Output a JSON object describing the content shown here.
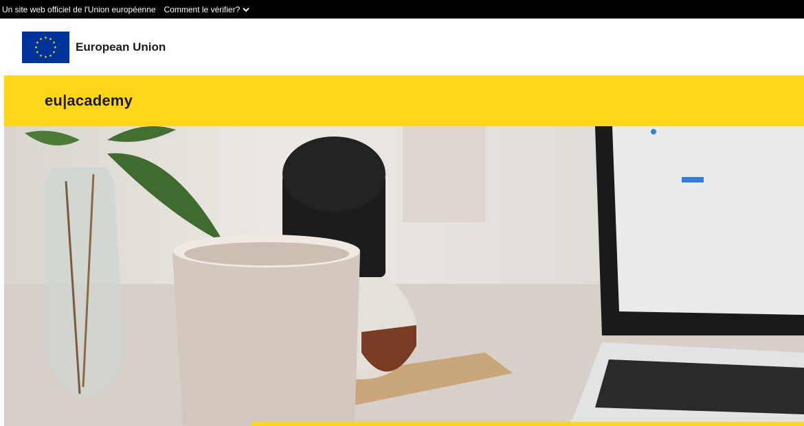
{
  "top_banner": {
    "official_text": "Un site web officiel de l'Union européenne",
    "verify_link": "Comment le vérifier?",
    "verify_icon": "chevron-down-icon"
  },
  "identity": {
    "name": "European Union",
    "flag_icon": "eu-flag-icon"
  },
  "academy": {
    "logo_text": "eu|academy"
  },
  "hero": {
    "image": "desk-with-mug-plant-laptop"
  },
  "colors": {
    "brand_yellow": "#fed618",
    "eu_blue": "#003399",
    "star_yellow": "#ffdd00",
    "banner_black": "#000000"
  }
}
